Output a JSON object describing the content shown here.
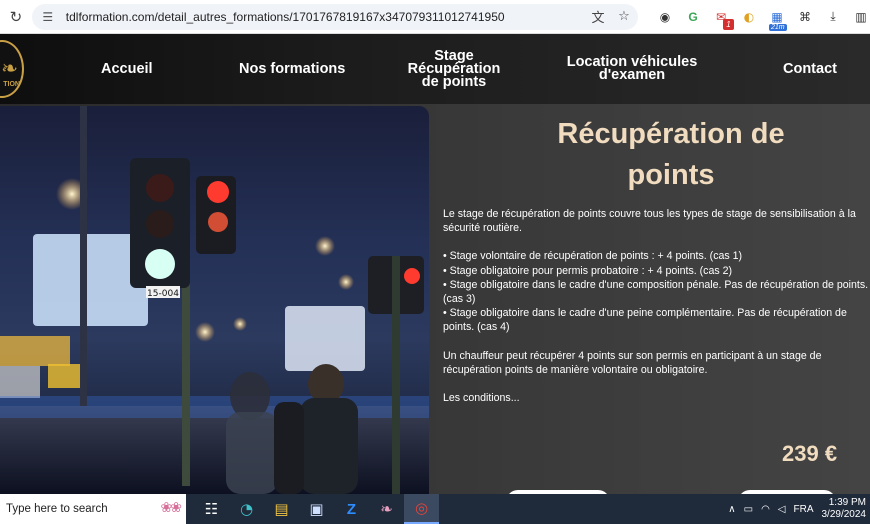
{
  "browser": {
    "url": "tdlformation.com/detail_autres_formations/1701767819167x347079311012741950",
    "extensions": [
      {
        "icon": "circle-ext-icon"
      },
      {
        "icon": "g-ext-icon",
        "color": "#3aa757"
      },
      {
        "icon": "mail-ext-icon",
        "badge": "1"
      },
      {
        "icon": "colorful-ext-icon"
      },
      {
        "icon": "calendar-ext-icon",
        "badge": "21m"
      },
      {
        "icon": "puzzle-icon"
      },
      {
        "icon": "download-icon"
      },
      {
        "icon": "sidebar-icon"
      }
    ]
  },
  "site": {
    "logo_text": "TION",
    "nav": {
      "home": "Accueil",
      "formations": "Nos formations",
      "stage_line1": "Stage",
      "stage_line2": "Récupération",
      "stage_line3": "de points",
      "location_line1": "Location véhicules",
      "location_line2": "d'examen",
      "contact": "Contact"
    },
    "photo_sign": "15-004",
    "title_line1": "Récupération de",
    "title_line2": "points",
    "desc": {
      "intro_1": "Le stage de récupération de points couvre tous les types de stage de sensibilisation à la",
      "intro_2": "sécurité routière.",
      "b1": "• Stage volontaire de récupération de points : + 4 points. (cas 1)",
      "b2": "• Stage obligatoire pour permis probatoire : + 4 points. (cas 2)",
      "b3_1": "• Stage obligatoire dans le cadre d'une composition pénale. Pas de récupération de points.",
      "b3_2": "(cas 3)",
      "b4_1": "• Stage obligatoire dans le cadre d'une peine complémentaire. Pas de récupération de",
      "b4_2": "points. (cas 4)",
      "outro_1": "Un chauffeur peut récupérer 4 points sur son permis en participant à un stage de",
      "outro_2": "récupération points de manière volontaire ou obligatoire.",
      "conditions": "Les conditions..."
    },
    "price": "239 €"
  },
  "taskbar": {
    "search_placeholder": "Type here to search",
    "lang": "FRA",
    "time": "1:39 PM",
    "date": "3/29/2024"
  },
  "colors": {
    "accent": "#f1dcbf",
    "logo_gold": "#c9a045",
    "taskbar": "#1f2a3b"
  }
}
